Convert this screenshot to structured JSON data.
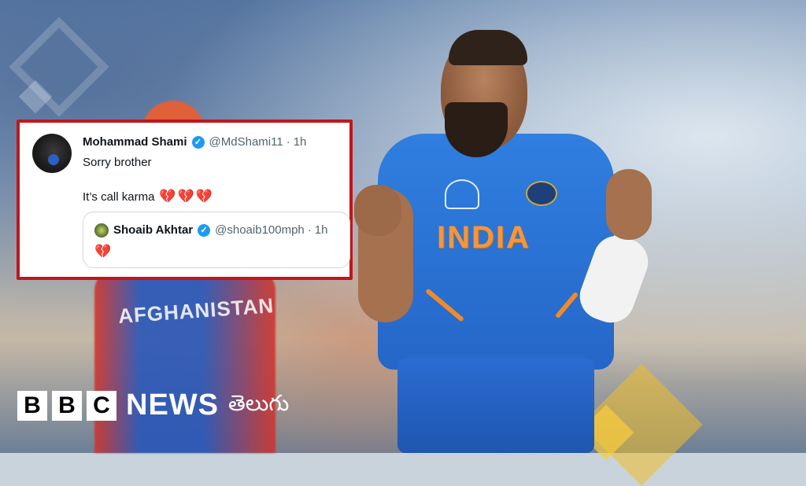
{
  "tweet": {
    "author_name": "Mohammad Shami",
    "author_handle": "@MdShami11",
    "separator": "·",
    "time": "1h",
    "line1": "Sorry brother",
    "line2": "It’s call karma",
    "line2_emoji": "💔💔💔",
    "quoted": {
      "author_name": "Shoaib Akhtar",
      "author_handle": "@shoaib100mph",
      "separator": "·",
      "time": "1h",
      "emoji": "💔"
    },
    "border_color": "#c0161c",
    "verified_color": "#1d9bf0"
  },
  "photo": {
    "jersey_text": "INDIA",
    "opponent_jersey_text": "AFGHANISTAN"
  },
  "brand": {
    "letters": [
      "B",
      "B",
      "C"
    ],
    "news": "NEWS",
    "language": "తెలుగు"
  }
}
